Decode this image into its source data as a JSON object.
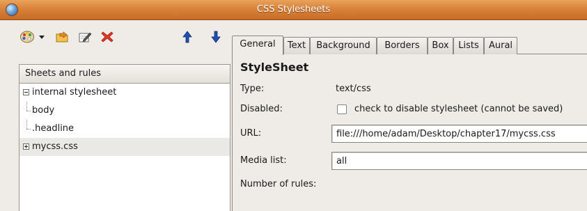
{
  "window": {
    "title": "CSS Stylesheets"
  },
  "toolbar": {
    "buttons": [
      {
        "icon": "palette-icon"
      },
      {
        "icon": "dropdown-arrow-icon"
      },
      {
        "icon": "import-icon"
      },
      {
        "icon": "edit-icon"
      },
      {
        "icon": "delete-icon"
      },
      {
        "icon": "move-up-icon"
      },
      {
        "icon": "move-down-icon"
      }
    ]
  },
  "tree": {
    "header": "Sheets and rules",
    "items": [
      {
        "label": "internal stylesheet",
        "expanded": true
      },
      {
        "label": "body"
      },
      {
        "label": ".headline"
      },
      {
        "label": "mycss.css",
        "expanded": false,
        "selected": true
      }
    ]
  },
  "tabs": [
    {
      "label": "General",
      "active": true
    },
    {
      "label": "Text"
    },
    {
      "label": "Background"
    },
    {
      "label": "Borders"
    },
    {
      "label": "Box"
    },
    {
      "label": "Lists"
    },
    {
      "label": "Aural"
    }
  ],
  "general": {
    "section_title": "StyleSheet",
    "type_label": "Type:",
    "type_value": "text/css",
    "disabled_label": "Disabled:",
    "disabled_checkbox_label": "check to disable stylesheet (cannot be saved)",
    "disabled_checked": false,
    "url_label": "URL:",
    "url_value": "file:///home/adam/Desktop/chapter17/mycss.css",
    "media_label": "Media list:",
    "media_value": "all",
    "rules_label": "Number of rules:"
  },
  "colors": {
    "titlebar": "#d9823a",
    "window_bg": "#efebe7",
    "arrow_blue": "#1f4fb5",
    "delete_red": "#e03a2a"
  }
}
